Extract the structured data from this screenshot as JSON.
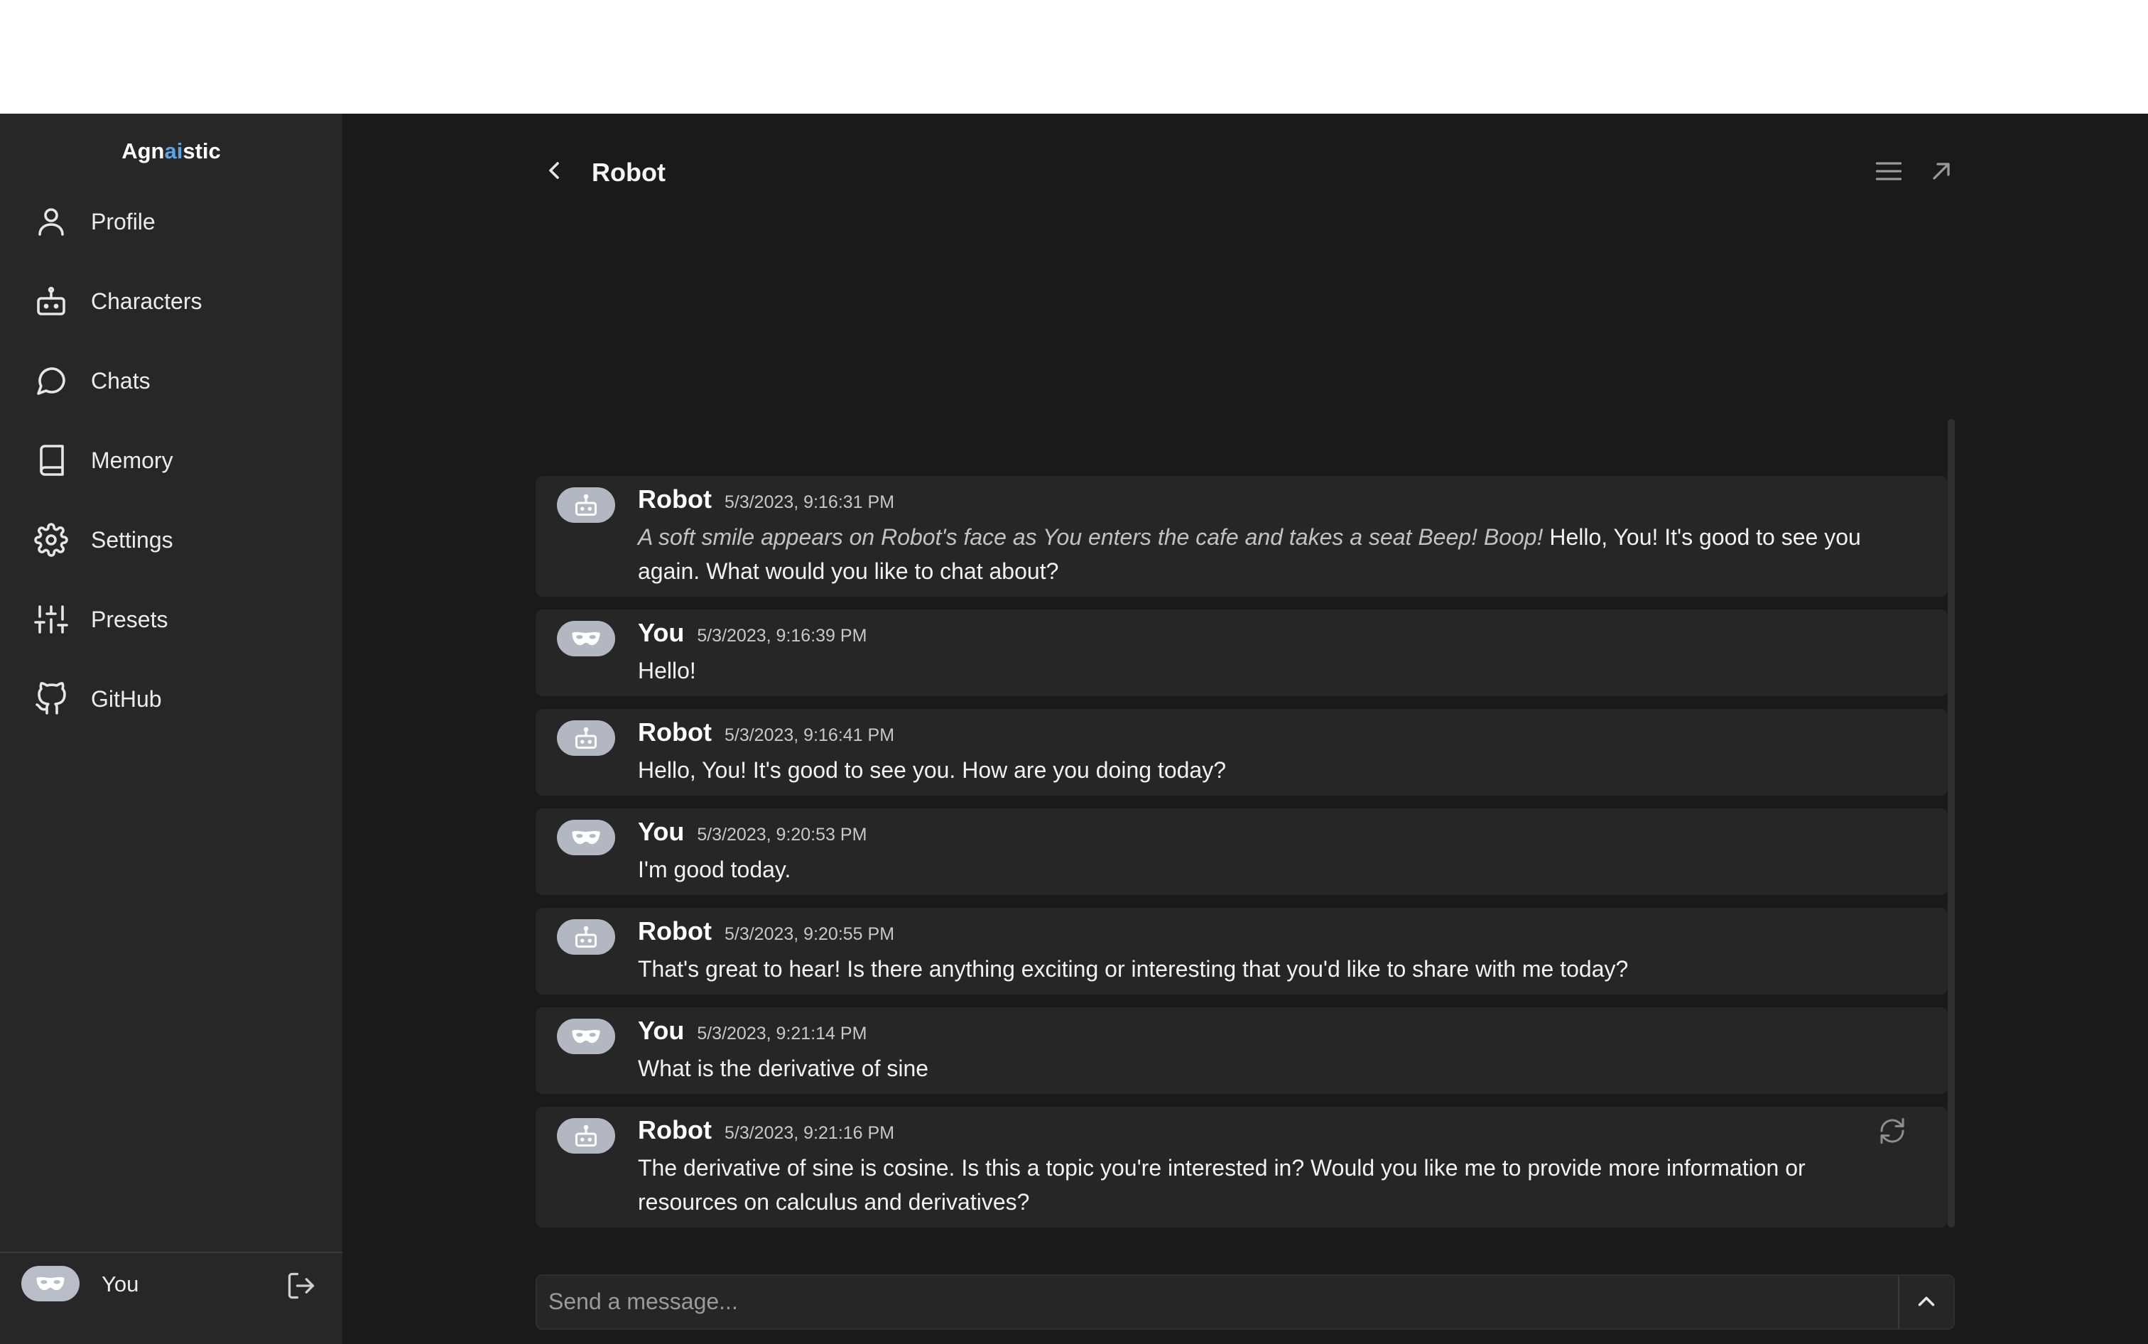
{
  "app": {
    "brand_prefix": "Agn",
    "brand_accent": "ai",
    "brand_suffix": "stic",
    "accent_color": "#5aa3e6"
  },
  "sidebar": {
    "items": [
      {
        "label": "Profile",
        "icon": "user-icon"
      },
      {
        "label": "Characters",
        "icon": "bot-icon"
      },
      {
        "label": "Chats",
        "icon": "chat-bubble-icon"
      },
      {
        "label": "Memory",
        "icon": "book-icon"
      },
      {
        "label": "Settings",
        "icon": "gear-icon"
      },
      {
        "label": "Presets",
        "icon": "sliders-icon"
      },
      {
        "label": "GitHub",
        "icon": "github-icon"
      }
    ]
  },
  "user": {
    "name": "You",
    "avatar_icon": "mask-icon",
    "logout_icon": "logout-icon"
  },
  "chat": {
    "title": "Robot",
    "messages": [
      {
        "author": "Robot",
        "time": "5/3/2023, 9:16:31 PM",
        "avatar_icon": "bot-icon",
        "action": "A soft smile appears on Robot's face as You enters the cafe and takes a seat Beep! Boop!",
        "text": "Hello, You! It's good to see you again. What would you like to chat about?"
      },
      {
        "author": "You",
        "time": "5/3/2023, 9:16:39 PM",
        "avatar_icon": "mask-icon",
        "text": "Hello!"
      },
      {
        "author": "Robot",
        "time": "5/3/2023, 9:16:41 PM",
        "avatar_icon": "bot-icon",
        "text": "Hello, You! It's good to see you. How are you doing today?"
      },
      {
        "author": "You",
        "time": "5/3/2023, 9:20:53 PM",
        "avatar_icon": "mask-icon",
        "text": "I'm good today."
      },
      {
        "author": "Robot",
        "time": "5/3/2023, 9:20:55 PM",
        "avatar_icon": "bot-icon",
        "text": "That's great to hear! Is there anything exciting or interesting that you'd like to share with me today?"
      },
      {
        "author": "You",
        "time": "5/3/2023, 9:21:14 PM",
        "avatar_icon": "mask-icon",
        "text": "What is the derivative of sine"
      },
      {
        "author": "Robot",
        "time": "5/3/2023, 9:21:16 PM",
        "avatar_icon": "bot-icon",
        "text": "The derivative of sine is cosine. Is this a topic you're interested in? Would you like me to provide more information or resources on calculus and derivatives?",
        "regenerate_icon": "refresh-icon"
      }
    ]
  },
  "composer": {
    "placeholder": "Send a message...",
    "value": ""
  }
}
